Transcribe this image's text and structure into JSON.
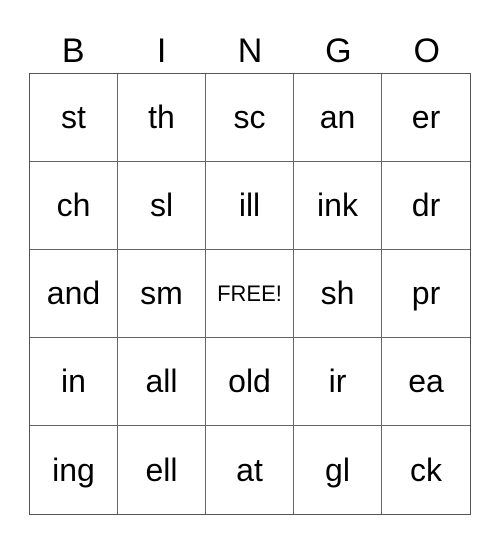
{
  "header": [
    "B",
    "I",
    "N",
    "G",
    "O"
  ],
  "rows": [
    [
      "st",
      "th",
      "sc",
      "an",
      "er"
    ],
    [
      "ch",
      "sl",
      "ill",
      "ink",
      "dr"
    ],
    [
      "and",
      "sm",
      "FREE!",
      "sh",
      "pr"
    ],
    [
      "in",
      "all",
      "old",
      "ir",
      "ea"
    ],
    [
      "ing",
      "ell",
      "at",
      "gl",
      "ck"
    ]
  ]
}
